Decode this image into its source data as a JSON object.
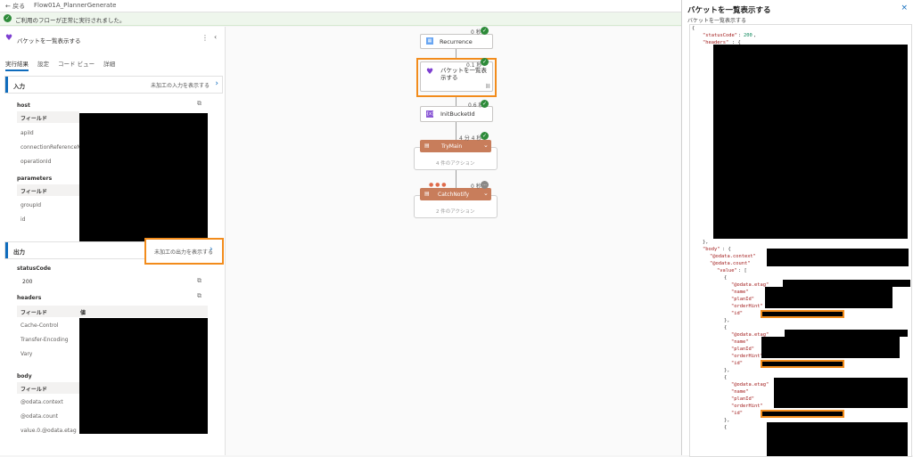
{
  "topbar": {
    "back_label": "戻る",
    "flow_name": "Flow01A_PlannerGenerate"
  },
  "banner": {
    "text": "ご利用のフローが正常に実行されました。"
  },
  "left": {
    "action_title": "バケットを一覧表示する",
    "tabs": [
      "実行結果",
      "設定",
      "コード ビュー",
      "詳細"
    ],
    "input_section": {
      "title": "入力",
      "link": "未加工の入力を表示する"
    },
    "host_label": "host",
    "field_header": "フィールド",
    "host_fields": [
      "apiId",
      "connectionReferenceN...",
      "operationId"
    ],
    "parameters_label": "parameters",
    "param_fields": [
      "groupId",
      "id"
    ],
    "output_section": {
      "title": "出力",
      "link": "未加工の出力を表示する"
    },
    "status_label": "statusCode",
    "status_value": "200",
    "headers_label": "headers",
    "value_header": "値",
    "header_fields": [
      "Cache-Control",
      "Transfer-Encoding",
      "Vary"
    ],
    "body_label": "body",
    "body_fields": [
      "@odata.context",
      "@odata.count",
      "value.0.@odata.etag"
    ]
  },
  "canvas": {
    "nodes": [
      {
        "name": "Recurrence",
        "duration": "0 秒"
      },
      {
        "name": "バケットを一覧表示する",
        "duration": "0.1 秒"
      },
      {
        "name": "InitBucketId",
        "duration": "0.6 秒"
      },
      {
        "name": "TryMain",
        "duration": "4 分 4 秒",
        "sub": "4 件のアクション"
      },
      {
        "name": "CatchNotify",
        "duration": "0 秒",
        "sub": "2 件のアクション"
      }
    ],
    "skip_badge": "..."
  },
  "right": {
    "title": "バケットを一覧表示する",
    "subtitle": "バケットを一覧表示する",
    "close_icon": "×",
    "code": {
      "open": "{",
      "status_key": "\"statusCode\"",
      "status_val": "200",
      "headers_key": "\"headers\"",
      "close_obj": "},",
      "body_key": "\"body\"",
      "ctx_key": "\"@odata.context\"",
      "count_key": "\"@odata.count\"",
      "value_key": "\"value\"",
      "etag_key": "\"@odata.etag\"",
      "name_key": "\"name\"",
      "plan_key": "\"planId\"",
      "order_key": "\"orderHint\"",
      "id_key": "\"id\""
    }
  }
}
